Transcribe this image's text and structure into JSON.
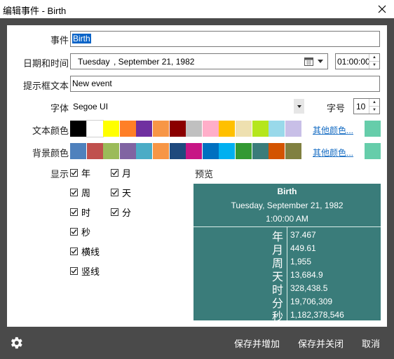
{
  "window": {
    "title": "编辑事件 - Birth"
  },
  "form": {
    "event_label": "事件",
    "event_value": "Birth",
    "datetime_label": "日期和时间",
    "date_weekday": "Tuesday",
    "date_rest": ", September 21, 1982",
    "time_value": "01:00:00",
    "tooltip_label": "提示框文本",
    "tooltip_value": "New event",
    "font_label": "字体",
    "font_value": "Segoe UI",
    "fontsize_label": "字号",
    "fontsize_value": "10",
    "textcolor_label": "文本颜色",
    "bgcolor_label": "背景颜色",
    "more_colors": "其他颜色...",
    "display_label": "显示",
    "preview_label": "预览"
  },
  "text_colors": [
    "#000000",
    "#ffffff",
    "#ffff00",
    "#ff7f27",
    "#7030a0",
    "#f79646",
    "#8b0000",
    "#c0c0c0",
    "#ffaec9",
    "#ffc000",
    "#eee0b0",
    "#b5e61d",
    "#99d9ea",
    "#c8bfe7"
  ],
  "text_color_selected": "#66cdaa",
  "bg_colors": [
    "#4f81bd",
    "#c0504d",
    "#9bbb59",
    "#8064a2",
    "#4bacc6",
    "#f79646",
    "#1f497d",
    "#c71585",
    "#0070c0",
    "#00b0f0",
    "#339933",
    "#3a7c7a",
    "#d35400",
    "#808040"
  ],
  "bg_color_selected": "#66cdaa",
  "display_options": {
    "col1": [
      {
        "label": "年",
        "checked": true
      },
      {
        "label": "周",
        "checked": true
      },
      {
        "label": "时",
        "checked": true
      },
      {
        "label": "秒",
        "checked": true
      },
      {
        "label": "横线",
        "checked": true
      },
      {
        "label": "竖线",
        "checked": true
      }
    ],
    "col2": [
      {
        "label": "月",
        "checked": true
      },
      {
        "label": "天",
        "checked": true
      },
      {
        "label": "分",
        "checked": true
      }
    ],
    "check_glyph": "☑"
  },
  "preview": {
    "title": "Birth",
    "date": "Tuesday, September 21, 1982",
    "time": "1:00:00 AM",
    "rows": [
      {
        "unit": "年",
        "value": "37.467"
      },
      {
        "unit": "月",
        "value": "449.61"
      },
      {
        "unit": "周",
        "value": "1,955"
      },
      {
        "unit": "天",
        "value": "13,684.9"
      },
      {
        "unit": "时",
        "value": "328,438.5"
      },
      {
        "unit": "分",
        "value": "19,706,309"
      },
      {
        "unit": "秒",
        "value": "1,182,378,546"
      }
    ]
  },
  "footer": {
    "save_add": "保存并增加",
    "save_close": "保存并关闭",
    "cancel": "取消"
  },
  "icons": {
    "close": "close-icon",
    "calendar": "calendar-icon",
    "gear": "gear-icon",
    "dropdown": "chevron-down-icon"
  }
}
